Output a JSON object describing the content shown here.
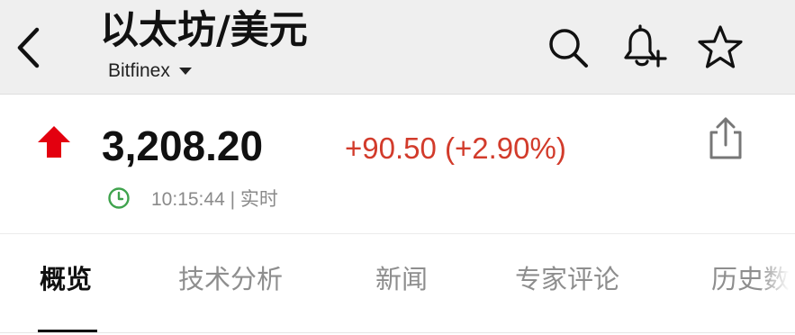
{
  "header": {
    "title": "以太坊/美元",
    "exchange": "Bitfinex",
    "icons": [
      "back-arrow-icon",
      "search-icon",
      "bell-plus-icon",
      "star-icon"
    ]
  },
  "quote": {
    "direction_icon": "up-arrow-icon",
    "price": "3,208.20",
    "change": "+90.50 (+2.90%)",
    "time": "10:15:44 | 实时",
    "up_color": "#e3000f",
    "change_color": "#d23b2b",
    "clock_color": "#3fa34d"
  },
  "tabs": [
    {
      "label": "概览",
      "active": true
    },
    {
      "label": "技术分析",
      "active": false
    },
    {
      "label": "新闻",
      "active": false
    },
    {
      "label": "专家评论",
      "active": false
    },
    {
      "label": "历史数",
      "active": false
    }
  ]
}
